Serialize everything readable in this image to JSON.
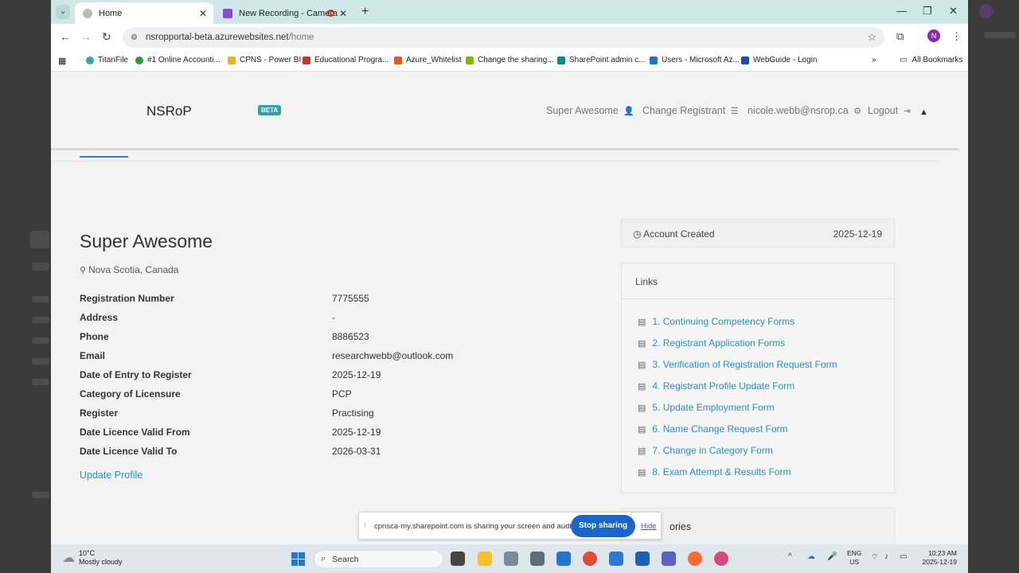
{
  "browser": {
    "tabs": [
      {
        "title": "Home"
      },
      {
        "title": "New Recording - Camera"
      }
    ],
    "url_host": "nsropportal-beta.azurewebsites.net",
    "url_path": "/home",
    "bookmarks": [
      "TitanFile",
      "#1 Online Accounti...",
      "CPNS - Power BI",
      "Educational Progra...",
      "Azure_Whitelist",
      "Change the sharing...",
      "SharePoint admin c...",
      "Users - Microsoft Az...",
      "WebGuide - Login"
    ],
    "all_bookmarks": "All Bookmarks",
    "profile_initial": "N"
  },
  "site": {
    "brand": "NSRoP",
    "beta": "BETA",
    "nav": {
      "user": "Super Awesome",
      "change_registrant": "Change Registrant",
      "email": "nicole.webb@nsrop.ca",
      "logout": "Logout"
    }
  },
  "profile": {
    "name": "Super Awesome",
    "location": "Nova Scotia, Canada",
    "rows": [
      {
        "label": "Registration Number",
        "value": "7775555"
      },
      {
        "label": "Address",
        "value": "-"
      },
      {
        "label": "Phone",
        "value": "8886523"
      },
      {
        "label": "Email",
        "value": "researchwebb@outlook.com"
      },
      {
        "label": "Date of Entry to Register",
        "value": "2025-12-19"
      },
      {
        "label": "Category of Licensure",
        "value": "PCP"
      },
      {
        "label": "Register",
        "value": "Practising"
      },
      {
        "label": "Date Licence Valid From",
        "value": "2025-12-19"
      },
      {
        "label": "Date Licence Valid To",
        "value": "2026-03-31"
      }
    ],
    "update_link": "Update Profile"
  },
  "account": {
    "created_label": "Account Created",
    "created_value": "2025-12-19"
  },
  "links": {
    "title": "Links",
    "items": [
      "1. Continuing Competency Forms",
      "2. Registrant Application Forms",
      "3. Verification of Registration Request Form",
      "4. Registrant Profile Update Form",
      "5. Update Employment Form",
      "6. Name Change Request Form",
      "7. Change in Category Form",
      "8. Exam Attempt & Results Form"
    ]
  },
  "partial_card": "ories",
  "share_banner": {
    "message": "cpnsca-my.sharepoint.com is sharing your screen and audio.",
    "stop": "Stop sharing",
    "hide": "Hide"
  },
  "taskbar": {
    "temp": "10°C",
    "weather": "Mostly cloudy",
    "search": "Search",
    "lang1": "ENG",
    "lang2": "US",
    "time": "10:23 AM",
    "date": "2025-12-19"
  }
}
